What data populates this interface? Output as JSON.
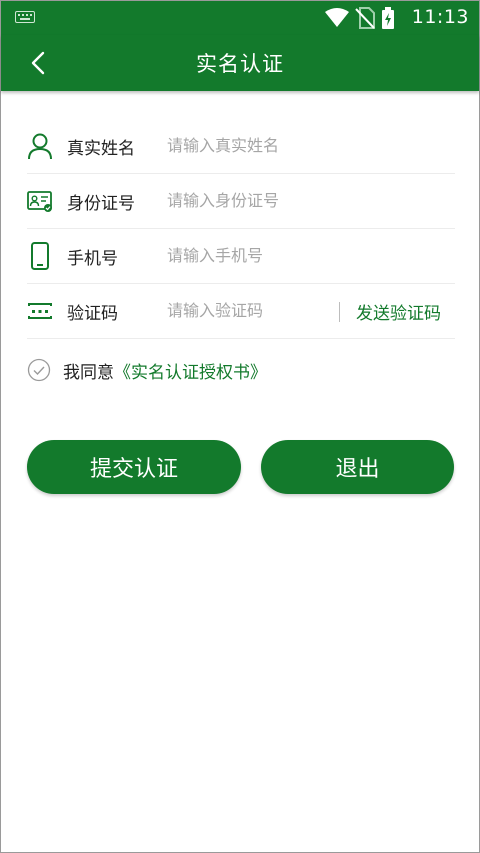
{
  "status_bar": {
    "time": "11:13"
  },
  "header": {
    "title": "实名认证"
  },
  "form": {
    "rows": [
      {
        "label": "真实姓名",
        "placeholder": "请输入真实姓名",
        "value": ""
      },
      {
        "label": "身份证号",
        "placeholder": "请输入身份证号",
        "value": ""
      },
      {
        "label": "手机号",
        "placeholder": "请输入手机号",
        "value": ""
      },
      {
        "label": "验证码",
        "placeholder": "请输入验证码",
        "value": ""
      }
    ],
    "send_code_label": "发送验证码"
  },
  "agreement": {
    "text": "我同意",
    "link": "《实名认证授权书》"
  },
  "buttons": {
    "submit": "提交认证",
    "exit": "退出"
  },
  "colors": {
    "brand": "#137a2c",
    "placeholder": "#a6a6a6"
  },
  "icons": {
    "back": "chevron-left-icon",
    "name": "person-icon",
    "id": "id-card-icon",
    "phone": "phone-icon",
    "code": "code-icon",
    "check": "circle-check-icon"
  }
}
